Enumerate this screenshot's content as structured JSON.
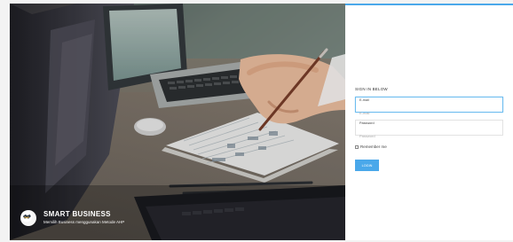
{
  "hero": {
    "brand_title": "SMART BUSINESS",
    "brand_subtitle": "Memilih Business menggunakan Metode AHP",
    "logo_icon": "business-logo-icon"
  },
  "login": {
    "heading": "SIGN IN BELOW",
    "email": {
      "label": "E-mail",
      "placeholder": "E-mail",
      "value": ""
    },
    "password": {
      "label": "Password",
      "placeholder": "Password",
      "value": ""
    },
    "remember_label": "Remember me",
    "button_label": "LOGIN"
  },
  "colors": {
    "accent": "#4aa8ea",
    "panel_background": "#ffffff",
    "hero_overlay": "#6f6a65"
  }
}
